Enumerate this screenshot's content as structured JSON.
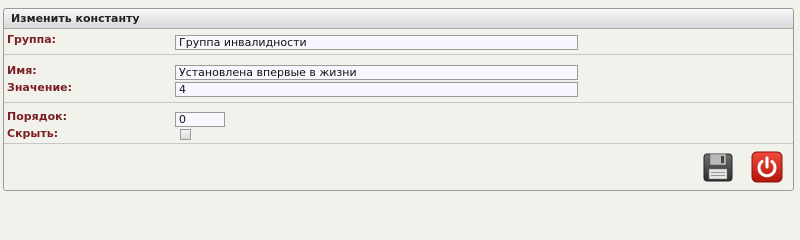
{
  "panel": {
    "title": "Изменить константу"
  },
  "form": {
    "group": {
      "label": "Группа:",
      "value": "Группа инвалидности"
    },
    "name": {
      "label": "Имя:",
      "value": "Установлена впервые в жизни"
    },
    "value": {
      "label": "Значение:",
      "value": "4"
    },
    "order": {
      "label": "Порядок:",
      "value": "0"
    },
    "hide": {
      "label": "Скрыть:",
      "checked": false
    }
  },
  "actions": {
    "save_icon": "floppy-disk-icon",
    "exit_icon": "power-icon"
  }
}
